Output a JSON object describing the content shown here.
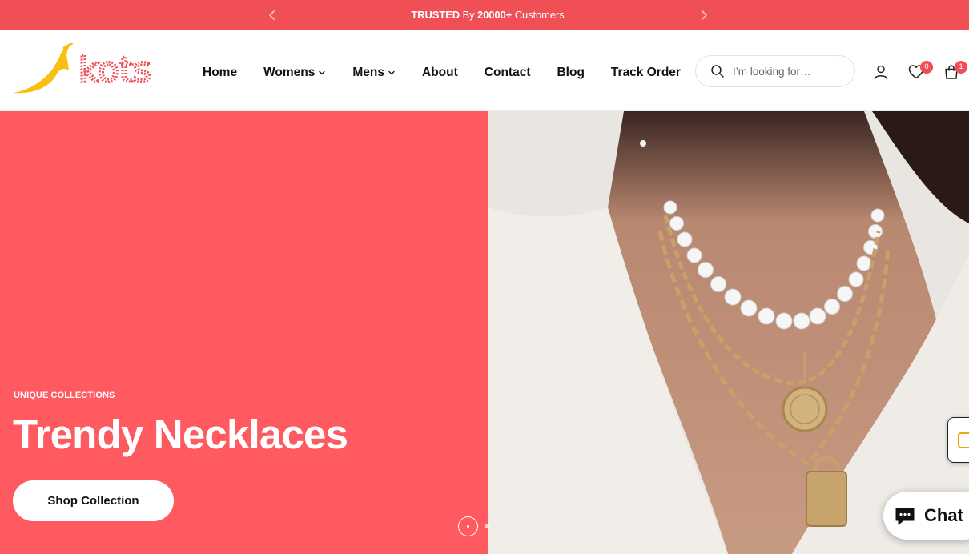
{
  "announcement": {
    "part1_bold": "TRUSTED",
    "part2": " By ",
    "part3_bold": "20000+",
    "part4": " Customers",
    "prev_icon": "chevron-left-icon",
    "next_icon": "chevron-right-icon"
  },
  "brand": {
    "logo_text": "kots",
    "logo_color": "#ef4f55",
    "mark_color": "#f7bf12"
  },
  "nav": {
    "items": [
      {
        "label": "Home",
        "has_dropdown": false
      },
      {
        "label": "Womens",
        "has_dropdown": true
      },
      {
        "label": "Mens",
        "has_dropdown": true
      },
      {
        "label": "About",
        "has_dropdown": false
      },
      {
        "label": "Contact",
        "has_dropdown": false
      },
      {
        "label": "Blog",
        "has_dropdown": false
      },
      {
        "label": "Track Order",
        "has_dropdown": false
      }
    ]
  },
  "search": {
    "placeholder": "I’m looking for…",
    "icon": "search-icon"
  },
  "header_icons": {
    "account": "user-icon",
    "wishlist": "heart-icon",
    "wishlist_count": "0",
    "cart": "shopping-bag-icon",
    "cart_count": "1"
  },
  "hero": {
    "eyebrow": "UNIQUE COLLECTIONS",
    "title": "Trendy Necklaces",
    "cta": "Shop Collection",
    "background_color": "#ff5a5f",
    "slide_current": 1,
    "slide_count": 2
  },
  "chat": {
    "label": "Chat",
    "icon": "chat-bubble-icon",
    "brand_color": "#008060"
  },
  "colors": {
    "accent": "#ef4f55",
    "hero_bg": "#ff5a5f"
  }
}
